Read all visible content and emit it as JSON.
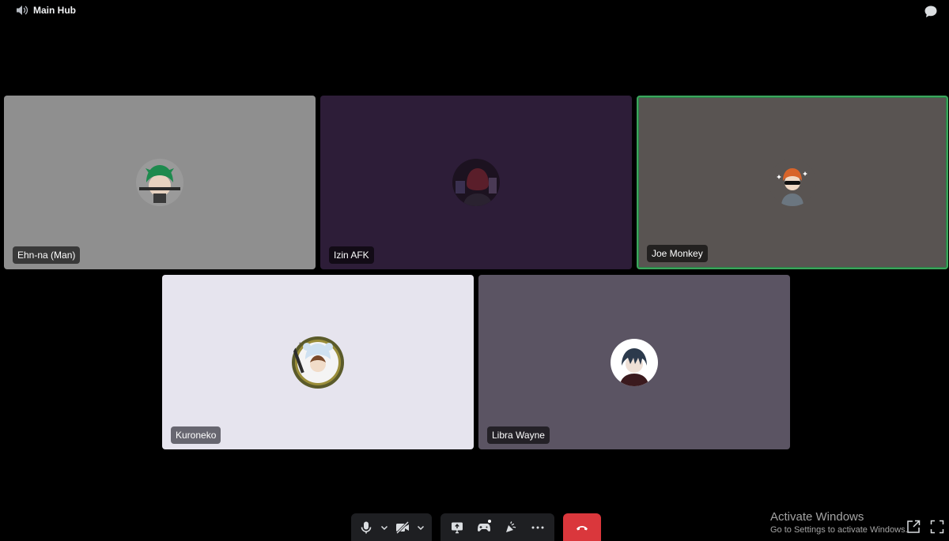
{
  "channel": {
    "name": "Main Hub",
    "icon": "voice-channel-icon"
  },
  "header": {
    "chat_icon": "chat-bubble-icon"
  },
  "participants": [
    {
      "name": "Ehn-na (Man)",
      "bg": "#8f8f8f",
      "speaking": false
    },
    {
      "name": "Izin AFK",
      "bg": "#2d1d38",
      "speaking": false
    },
    {
      "name": "Joe Monkey",
      "bg": "#595452",
      "speaking": true
    },
    {
      "name": "Kuroneko",
      "bg": "#e6e4ee",
      "speaking": false
    },
    {
      "name": "Libra Wayne",
      "bg": "#5b5463",
      "speaking": false
    }
  ],
  "controls": {
    "icons": [
      "microphone-icon",
      "camera-off-icon",
      "screen-share-icon",
      "activities-icon",
      "soundboard-icon",
      "more-icon",
      "hang-up-icon"
    ],
    "hangup_color": "#da373c"
  },
  "watermark": {
    "title": "Activate Windows",
    "subtitle": "Go to Settings to activate Windows."
  },
  "colors": {
    "speaking_border": "#3ba55c",
    "background": "#000000"
  }
}
